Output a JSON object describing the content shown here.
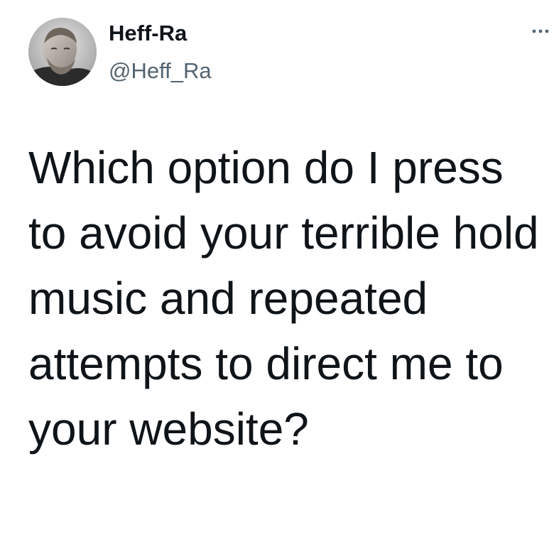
{
  "author": {
    "display_name": "Heff-Ra",
    "handle": "@Heff_Ra"
  },
  "tweet": {
    "text": "Which option do I press to avoid your terrible hold music and repeated attempts to direct me to your website?"
  },
  "icons": {
    "more": "more-horizontal-icon",
    "avatar": "profile-photo"
  },
  "colors": {
    "background": "#ffffff",
    "primary_text": "#0f1419",
    "secondary_text": "#536471"
  }
}
